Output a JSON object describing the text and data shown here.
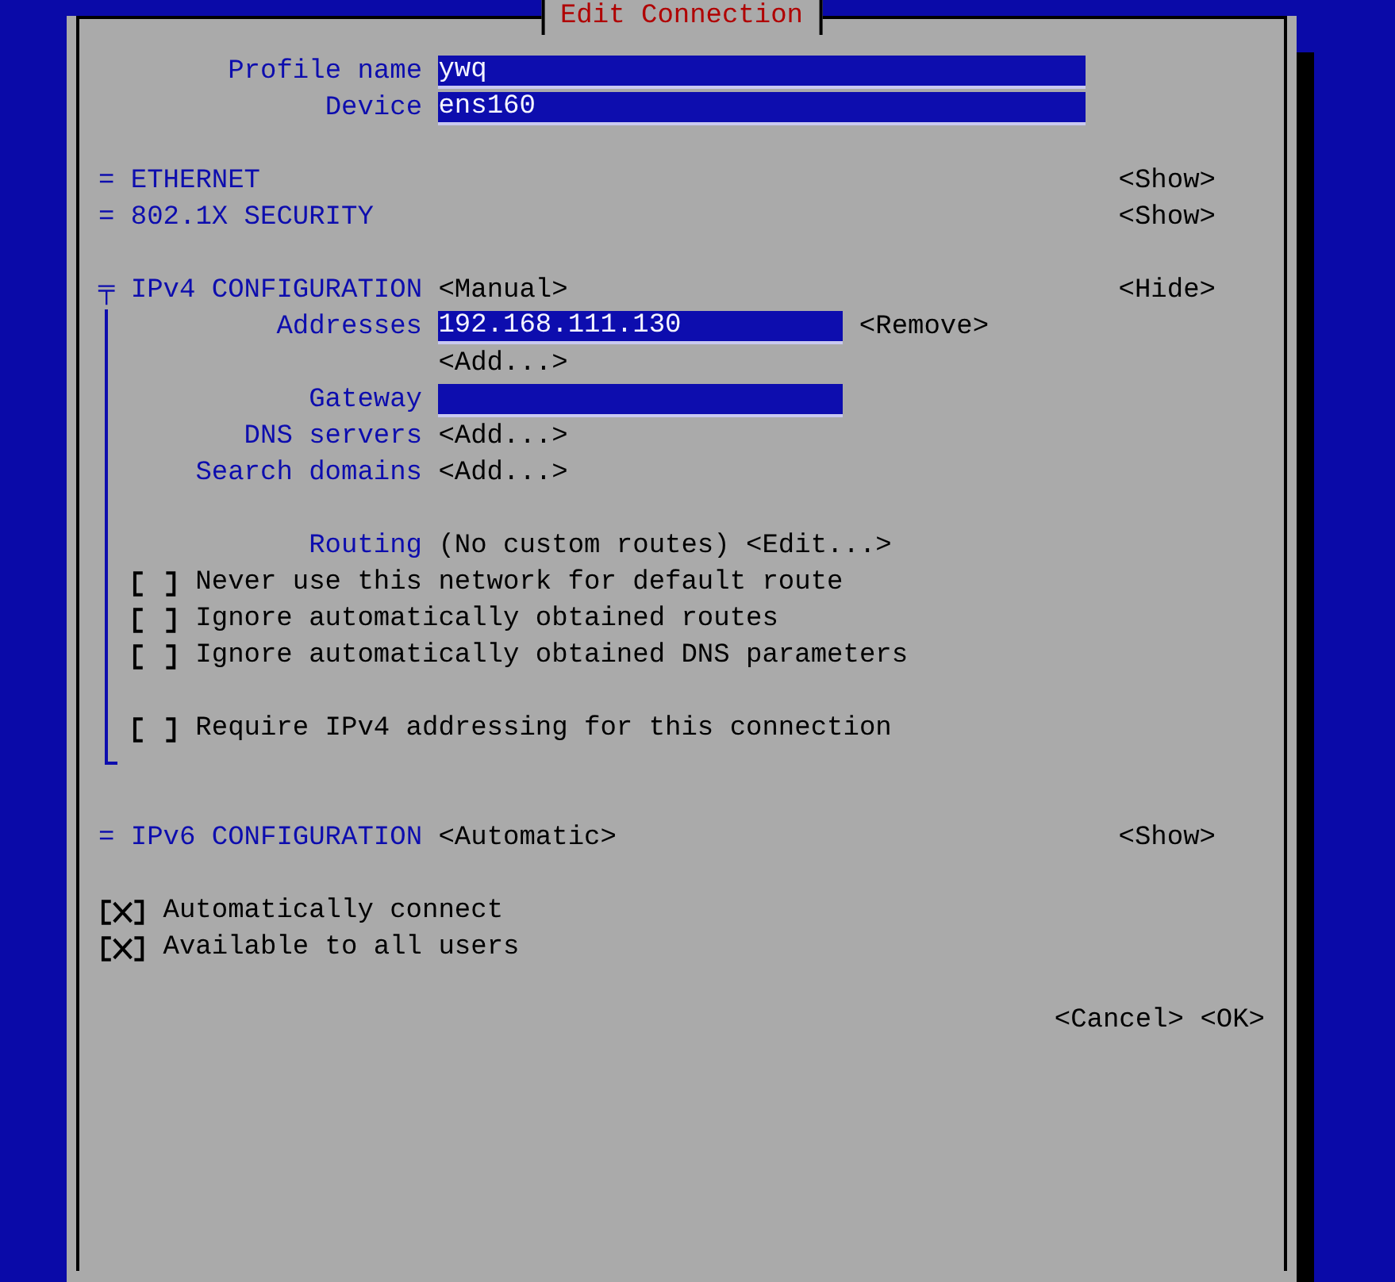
{
  "dialog_title": "Edit Connection",
  "profile": [
    {
      "label": "Profile name",
      "value": "ywq"
    },
    {
      "label": "Device",
      "value": "ens160"
    }
  ],
  "sections": [
    {
      "marker": "=",
      "title": "ETHERNET",
      "toggle": "<Show>",
      "expanded": false
    },
    {
      "marker": "=",
      "title": "802.1X SECURITY",
      "toggle": "<Show>",
      "expanded": false
    },
    {
      "marker": "╤",
      "title": "IPv4 CONFIGURATION",
      "mode": "<Manual>",
      "toggle": "<Hide>",
      "expanded": true,
      "groups": [
        [
          {
            "kind": "field",
            "label": "Addresses",
            "value": "192.168.111.130",
            "action": "<Remove>"
          },
          {
            "kind": "list",
            "button": "<Add...>"
          },
          {
            "kind": "field",
            "label": "Gateway"
          },
          {
            "kind": "list",
            "label": "DNS servers",
            "button": "<Add...>"
          },
          {
            "kind": "list",
            "label": "Search domains",
            "button": "<Add...>"
          }
        ],
        [
          {
            "kind": "routing",
            "label": "Routing",
            "text": "(No custom routes)",
            "button": "<Edit...>"
          },
          {
            "kind": "checkbox",
            "text": "Never use this network for default route",
            "checked": false
          },
          {
            "kind": "checkbox",
            "text": "Ignore automatically obtained routes",
            "checked": false
          },
          {
            "kind": "checkbox",
            "text": "Ignore automatically obtained DNS parameters",
            "checked": false
          }
        ],
        [
          {
            "kind": "checkbox",
            "text": "Require IPv4 addressing for this connection",
            "checked": false
          }
        ]
      ]
    },
    {
      "marker": "=",
      "title": "IPv6 CONFIGURATION",
      "mode": "<Automatic>",
      "toggle": "<Show>",
      "expanded": false
    }
  ],
  "options": [
    {
      "text": "Automatically connect",
      "checked": true
    },
    {
      "text": "Available to all users",
      "checked": true
    }
  ],
  "buttons": [
    "<Cancel>",
    "<OK>"
  ]
}
